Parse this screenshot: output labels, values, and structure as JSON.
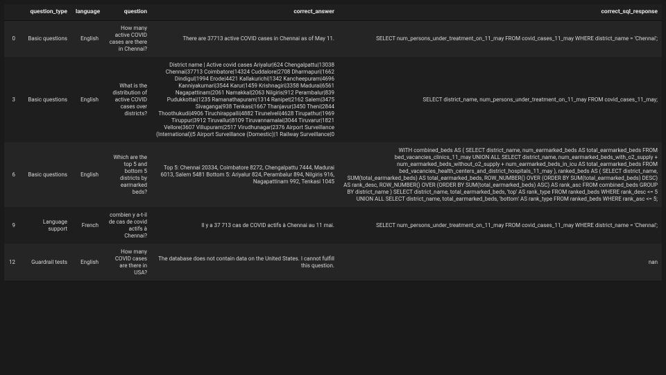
{
  "table": {
    "columns": [
      {
        "key": "idx",
        "label": ""
      },
      {
        "key": "question_type",
        "label": "question_type"
      },
      {
        "key": "language",
        "label": "language"
      },
      {
        "key": "question",
        "label": "question"
      },
      {
        "key": "correct_answer",
        "label": "correct_answer"
      },
      {
        "key": "correct_sql",
        "label": "correct_sql_response"
      }
    ],
    "rows": [
      {
        "idx": "0",
        "question_type": "Basic questions",
        "language": "English",
        "question": "How many active COVID cases are there in Chennai?",
        "correct_answer": "There are 37713 active COVID cases in Chennai as of May 11.",
        "correct_sql": "SELECT num_persons_under_treatment_on_11_may FROM covid_cases_11_may WHERE district_name = 'Chennai';"
      },
      {
        "idx": "3",
        "question_type": "Basic questions",
        "language": "English",
        "question": "What is the distribution of active COVID cases over districts?",
        "correct_answer": "District name | Active covid cases Ariyalur|624 Chengalpattu|13038 Chennai|37713 Coimbatore|14324 Cuddalore|2708 Dharmapuri|1662 Dindigul|1994 Erode|4421 Kallakurichi|1342 Kancheepuram|4696 Kanniyakumari|3544 Karur|1459 Krishnagiri|3358 Madurai|6561 Nagapattinam|2061 Namakkal|2063 Nilgiris|912 Perambalur|839 Pudukkottai|1235 Ramanathapuram|1314 Ranipet|2162 Salem|3475 Sivaganga|938 Tenkasi|1667 Thanjavur|3450 Theni|2844 Thoothukudi|4906 Tiruchirappalli|4882 Tirunelveli|4628 Tirupathur|1969 Tiruppur|3912 Tiruvallur|8109 Tiruvannamalai|3044 Tiruvarur|1821 Vellore|3607 Villupuram|2517 Virudhunagar|2376 Airport Surveillance (International)|5 Airport Surveillance (Domestic)|1 Railway Surveillance|0",
        "correct_sql": "SELECT district_name, num_persons_under_treatment_on_11_may FROM covid_cases_11_may;"
      },
      {
        "idx": "6",
        "question_type": "Basic questions",
        "language": "English",
        "question": "Which are the top 5 and bottom 5 districts by earmarked beds?",
        "correct_answer": "Top 5: Chennai 20334, Coimbatore 8272, Chengalpattu 7444, Madurai 6013, Salem 5481 Bottom 5: Ariyalur 824, Perambalur 894, Nilgiris 916, Nagapattinam 992, Tenkasi 1045",
        "correct_sql": "WITH combined_beds AS ( SELECT district_name, num_earmarked_beds AS total_earmarked_beds FROM bed_vacancies_clinics_11_may UNION ALL SELECT district_name, num_earmarked_beds_with_o2_supply + num_earmarked_beds_without_o2_supply + num_earmarked_beds_in_icu AS total_earmarked_beds FROM bed_vacancies_health_centers_and_district_hospitals_11_may ), ranked_beds AS ( SELECT district_name, SUM(total_earmarked_beds) AS total_earmarked_beds, ROW_NUMBER() OVER (ORDER BY SUM(total_earmarked_beds) DESC) AS rank_desc, ROW_NUMBER() OVER (ORDER BY SUM(total_earmarked_beds) ASC) AS rank_asc FROM combined_beds GROUP BY district_name ) SELECT district_name, total_earmarked_beds, 'top' AS rank_type FROM ranked_beds WHERE rank_desc <= 5 UNION ALL SELECT district_name, total_earmarked_beds, 'bottom' AS rank_type FROM ranked_beds WHERE rank_asc <= 5;"
      },
      {
        "idx": "9",
        "question_type": "Language support",
        "language": "French",
        "question": "combien y a-t-il de cas de covid actifs à Chennai?",
        "correct_answer": "Il y a 37 713 cas de COVID actifs à Chennai au 11 mai.",
        "correct_sql": "SELECT num_persons_under_treatment_on_11_may FROM covid_cases_11_may WHERE district_name = 'Chennai';"
      },
      {
        "idx": "12",
        "question_type": "Guardrail tests",
        "language": "English",
        "question": "How many COVID cases are there in USA?",
        "correct_answer": "The database does not contain data on the United States. I cannot fulfill this question.",
        "correct_sql": "nan"
      }
    ]
  }
}
